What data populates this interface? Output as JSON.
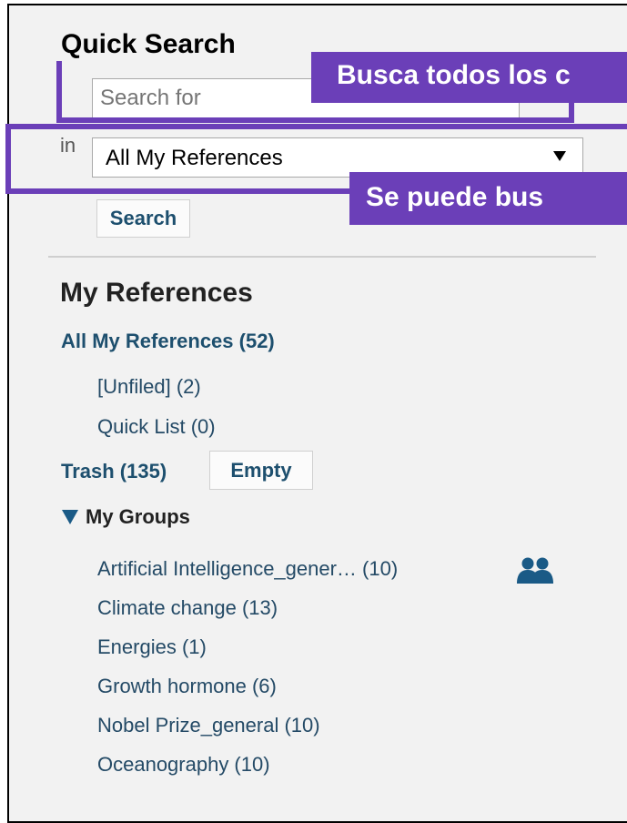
{
  "quick_search": {
    "title": "Quick Search",
    "placeholder": "Search for",
    "in_label": "in",
    "scope_value": "All My References",
    "search_button": "Search"
  },
  "callouts": {
    "top": "Busca todos los c",
    "bottom": "Se puede bus"
  },
  "my_references": {
    "title": "My References",
    "all": "All My References (52)",
    "unfiled": "[Unfiled] (2)",
    "quick_list": "Quick List (0)",
    "trash": "Trash (135)",
    "empty_button": "Empty"
  },
  "groups": {
    "header": "My Groups",
    "items": [
      {
        "label": "Artificial Intelligence_gener…  (10)",
        "shared": true
      },
      {
        "label": "Climate change  (13)"
      },
      {
        "label": "Energies  (1)"
      },
      {
        "label": "Growth hormone  (6)"
      },
      {
        "label": "Nobel Prize_general  (10)"
      },
      {
        "label": "Oceanography  (10)"
      }
    ]
  },
  "colors": {
    "accent": "#6b3fb8",
    "link": "#1d4f6e",
    "panel_bg": "#f2f2f2"
  },
  "icons": [
    "dropdown-arrow-icon",
    "expand-triangle-icon",
    "shared-group-icon"
  ]
}
